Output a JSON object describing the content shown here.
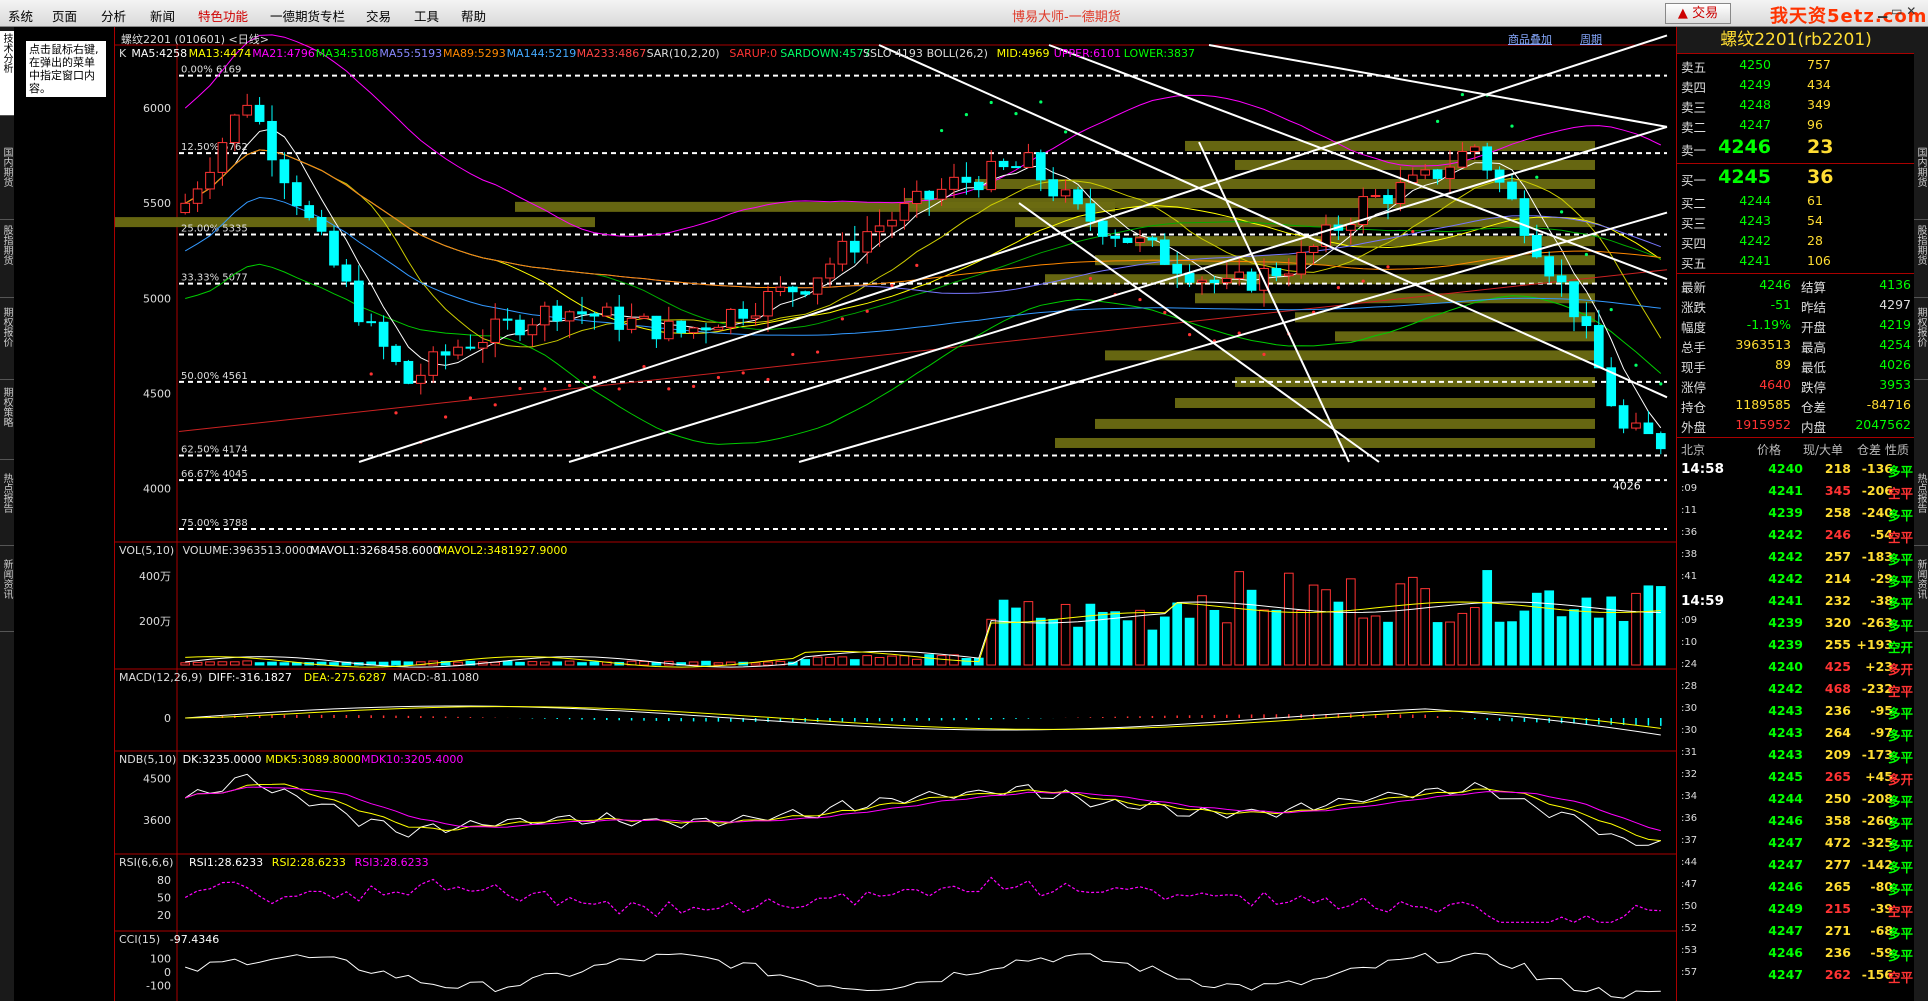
{
  "menu": [
    "系统",
    "页面",
    "分析",
    "新闻",
    "特色功能",
    "一德期货专栏",
    "交易",
    "工具",
    "帮助"
  ],
  "app_title": "博易大师-一德期货",
  "trade_button": "交易",
  "watermark": "我天资5etz.com",
  "left_tabs": [
    "技术分析",
    "国内期货",
    "股指期货",
    "期权报价",
    "期权策略",
    "热点报告",
    "新闻资讯"
  ],
  "right_tabs": [
    "国内期货",
    "股指期货",
    "期权报价",
    "热点报告",
    "新闻资讯"
  ],
  "hint": "点击鼠标右键,在弹出的菜单中指定窗口内容。",
  "chart_title": "螺纹2201 (010601) <日线>",
  "chart_buttons": [
    "商品叠加",
    "周期"
  ],
  "indicators": {
    "main": [
      {
        "t": "K",
        "c": "#dddddd"
      },
      {
        "t": "MA5:4258",
        "c": "#ffffff"
      },
      {
        "t": "MA13:4474",
        "c": "#ffff00"
      },
      {
        "t": "MA21:4796",
        "c": "#ff00ff"
      },
      {
        "t": "MA34:5108",
        "c": "#00ff00"
      },
      {
        "t": "MA55:5193",
        "c": "#8888ff"
      },
      {
        "t": "MA89:5293",
        "c": "#ff8800"
      },
      {
        "t": "MA144:5219",
        "c": "#44aaff"
      },
      {
        "t": "MA233:4867",
        "c": "#ff4444"
      },
      {
        "t": "SAR(10,2,20)",
        "c": "#dddddd"
      },
      {
        "t": "SARUP:0",
        "c": "#ff3333"
      },
      {
        "t": "SARDOWN:4577",
        "c": "#00ff66"
      },
      {
        "t": "SSLO 4193",
        "c": "#dddddd"
      },
      {
        "t": "BOLL(26,2)",
        "c": "#dddddd"
      },
      {
        "t": "MID:4969",
        "c": "#ffff00"
      },
      {
        "t": "UPPER:6101",
        "c": "#ff00ff"
      },
      {
        "t": "LOWER:3837",
        "c": "#00ff00"
      }
    ],
    "vol": [
      {
        "t": "VOL(5,10)",
        "c": "#dddddd"
      },
      {
        "t": "VOLUME:3963513.0000",
        "c": "#dddddd"
      },
      {
        "t": "MAVOL1:3268458.6000",
        "c": "#ffffff"
      },
      {
        "t": "MAVOL2:3481927.9000",
        "c": "#ffff00"
      }
    ],
    "macd": [
      {
        "t": "MACD(12,26,9)",
        "c": "#dddddd"
      },
      {
        "t": "DIFF:-316.1827",
        "c": "#ffffff"
      },
      {
        "t": "DEA:-275.6287",
        "c": "#ffff00"
      },
      {
        "t": "MACD:-81.1080",
        "c": "#dddddd"
      }
    ],
    "ndb": [
      {
        "t": "NDB(5,10)",
        "c": "#dddddd"
      },
      {
        "t": "DK:3235.0000",
        "c": "#ffffff"
      },
      {
        "t": "MDK5:3089.8000",
        "c": "#ffff00"
      },
      {
        "t": "MDK10:3205.4000",
        "c": "#ff00ff"
      }
    ],
    "rsi": [
      {
        "t": "RSI(6,6,6)",
        "c": "#dddddd"
      },
      {
        "t": "RSI1:28.6233",
        "c": "#ffffff"
      },
      {
        "t": "RSI2:28.6233",
        "c": "#ffff00"
      },
      {
        "t": "RSI3:28.6233",
        "c": "#ff00ff"
      }
    ],
    "cci": [
      {
        "t": "CCI(15)",
        "c": "#dddddd"
      },
      {
        "t": "-97.4346",
        "c": "#ffffff"
      }
    ]
  },
  "axis": {
    "price_ticks": [
      "6000",
      "5500",
      "5000",
      "4500",
      "4000"
    ],
    "vol_ticks": [
      "400万",
      "200万"
    ],
    "macd_ticks": [
      "0"
    ],
    "ndb_ticks": [
      "4500",
      "3600"
    ],
    "rsi_ticks": [
      "80",
      "50",
      "20"
    ],
    "cci_ticks": [
      "100",
      "0",
      "-100"
    ]
  },
  "fib_levels": [
    {
      "label": "0.00%  6169",
      "v": 6169
    },
    {
      "label": "12.50%  5762",
      "v": 5762
    },
    {
      "label": "25.00%  5335",
      "v": 5335
    },
    {
      "label": "33.33%  5077",
      "v": 5077
    },
    {
      "label": "50.00%  4561",
      "v": 4561
    },
    {
      "label": "62.50%  4174",
      "v": 4174
    },
    {
      "label": "66.67%  4045",
      "v": 4045
    },
    {
      "label": "75.00%  3788",
      "v": 3788
    }
  ],
  "low_label": "4026",
  "quote": {
    "title": "螺纹2201(rb2201)",
    "asks": [
      {
        "label": "卖五",
        "price": "4250",
        "vol": "757"
      },
      {
        "label": "卖四",
        "price": "4249",
        "vol": "434"
      },
      {
        "label": "卖三",
        "price": "4248",
        "vol": "349"
      },
      {
        "label": "卖二",
        "price": "4247",
        "vol": "96"
      },
      {
        "label": "卖一",
        "price": "4246",
        "vol": "23"
      }
    ],
    "bids": [
      {
        "label": "买一",
        "price": "4245",
        "vol": "36"
      },
      {
        "label": "买二",
        "price": "4244",
        "vol": "61"
      },
      {
        "label": "买三",
        "price": "4243",
        "vol": "54"
      },
      {
        "label": "买四",
        "price": "4242",
        "vol": "28"
      },
      {
        "label": "买五",
        "price": "4241",
        "vol": "106"
      }
    ],
    "stats": [
      {
        "l1": "最新",
        "v1": "4246",
        "c1": "#00ff00",
        "l2": "结算",
        "v2": "4136",
        "c2": "#00ff00"
      },
      {
        "l1": "涨跌",
        "v1": "-51",
        "c1": "#00ff00",
        "l2": "昨结",
        "v2": "4297",
        "c2": "#dddddd"
      },
      {
        "l1": "幅度",
        "v1": "-1.19%",
        "c1": "#00ff00",
        "l2": "开盘",
        "v2": "4219",
        "c2": "#00ff00"
      },
      {
        "l1": "总手",
        "v1": "3963513",
        "c1": "#ffdd33",
        "l2": "最高",
        "v2": "4254",
        "c2": "#00ff00"
      },
      {
        "l1": "现手",
        "v1": "89",
        "c1": "#ffdd33",
        "l2": "最低",
        "v2": "4026",
        "c2": "#00ff00"
      },
      {
        "l1": "涨停",
        "v1": "4640",
        "c1": "#ff3333",
        "l2": "跌停",
        "v2": "3953",
        "c2": "#00ff00"
      },
      {
        "l1": "持仓",
        "v1": "1189585",
        "c1": "#ffdd33",
        "l2": "仓差",
        "v2": "-84716",
        "c2": "#ffdd33"
      },
      {
        "l1": "外盘",
        "v1": "1915952",
        "c1": "#ff3333",
        "l2": "内盘",
        "v2": "2047562",
        "c2": "#00ff00"
      }
    ],
    "tick_headers": [
      "北京",
      "价格",
      "现/大单",
      "仓差",
      "性质"
    ],
    "ticks": [
      {
        "t": "14:58",
        "p": "4240",
        "v": "218",
        "o": "-136",
        "n": "多平",
        "pc": "#00ff00",
        "vc": "#ffdd33",
        "oc": "#ffdd33",
        "nc": "#00ff00",
        "big": true
      },
      {
        "t": ":09",
        "p": "4241",
        "v": "345",
        "o": "-206",
        "n": "空平",
        "pc": "#00ff00",
        "vc": "#ff3333",
        "oc": "#ffdd33",
        "nc": "#ff3333",
        "big": false
      },
      {
        "t": ":11",
        "p": "4239",
        "v": "258",
        "o": "-240",
        "n": "多平",
        "pc": "#00ff00",
        "vc": "#ffdd33",
        "oc": "#ffdd33",
        "nc": "#00ff00",
        "big": false
      },
      {
        "t": ":36",
        "p": "4242",
        "v": "246",
        "o": "-54",
        "n": "空平",
        "pc": "#00ff00",
        "vc": "#ff3333",
        "oc": "#ffdd33",
        "nc": "#ff3333",
        "big": false
      },
      {
        "t": ":38",
        "p": "4242",
        "v": "257",
        "o": "-183",
        "n": "多平",
        "pc": "#00ff00",
        "vc": "#ffdd33",
        "oc": "#ffdd33",
        "nc": "#00ff00",
        "big": false
      },
      {
        "t": ":41",
        "p": "4242",
        "v": "214",
        "o": "-29",
        "n": "多平",
        "pc": "#00ff00",
        "vc": "#ffdd33",
        "oc": "#ffdd33",
        "nc": "#00ff00",
        "big": false
      },
      {
        "t": "14:59",
        "p": "4241",
        "v": "232",
        "o": "-38",
        "n": "多平",
        "pc": "#00ff00",
        "vc": "#ffdd33",
        "oc": "#ffdd33",
        "nc": "#00ff00",
        "big": true
      },
      {
        "t": ":09",
        "p": "4239",
        "v": "320",
        "o": "-263",
        "n": "多平",
        "pc": "#00ff00",
        "vc": "#ffdd33",
        "oc": "#ffdd33",
        "nc": "#00ff00",
        "big": false
      },
      {
        "t": ":10",
        "p": "4239",
        "v": "255",
        "o": "+193",
        "n": "空开",
        "pc": "#00ff00",
        "vc": "#ffdd33",
        "oc": "#ffdd33",
        "nc": "#00ff00",
        "big": false
      },
      {
        "t": ":24",
        "p": "4240",
        "v": "425",
        "o": "+23",
        "n": "多开",
        "pc": "#00ff00",
        "vc": "#ff3333",
        "oc": "#ffdd33",
        "nc": "#ff3333",
        "big": false
      },
      {
        "t": ":28",
        "p": "4242",
        "v": "468",
        "o": "-232",
        "n": "空平",
        "pc": "#00ff00",
        "vc": "#ff3333",
        "oc": "#ffdd33",
        "nc": "#ff3333",
        "big": false
      },
      {
        "t": ":30",
        "p": "4243",
        "v": "236",
        "o": "-95",
        "n": "多平",
        "pc": "#00ff00",
        "vc": "#ffdd33",
        "oc": "#ffdd33",
        "nc": "#00ff00",
        "big": false
      },
      {
        "t": ":30",
        "p": "4243",
        "v": "264",
        "o": "-97",
        "n": "多平",
        "pc": "#00ff00",
        "vc": "#ffdd33",
        "oc": "#ffdd33",
        "nc": "#00ff00",
        "big": false
      },
      {
        "t": ":31",
        "p": "4243",
        "v": "209",
        "o": "-173",
        "n": "多平",
        "pc": "#00ff00",
        "vc": "#ffdd33",
        "oc": "#ffdd33",
        "nc": "#00ff00",
        "big": false
      },
      {
        "t": ":32",
        "p": "4245",
        "v": "265",
        "o": "+45",
        "n": "多开",
        "pc": "#00ff00",
        "vc": "#ff3333",
        "oc": "#ffdd33",
        "nc": "#ff3333",
        "big": false
      },
      {
        "t": ":34",
        "p": "4244",
        "v": "250",
        "o": "-208",
        "n": "多平",
        "pc": "#00ff00",
        "vc": "#ffdd33",
        "oc": "#ffdd33",
        "nc": "#00ff00",
        "big": false
      },
      {
        "t": ":36",
        "p": "4246",
        "v": "358",
        "o": "-260",
        "n": "多平",
        "pc": "#00ff00",
        "vc": "#ffdd33",
        "oc": "#ffdd33",
        "nc": "#00ff00",
        "big": false
      },
      {
        "t": ":37",
        "p": "4247",
        "v": "472",
        "o": "-325",
        "n": "多平",
        "pc": "#00ff00",
        "vc": "#ffdd33",
        "oc": "#ffdd33",
        "nc": "#00ff00",
        "big": false
      },
      {
        "t": ":44",
        "p": "4247",
        "v": "277",
        "o": "-142",
        "n": "多平",
        "pc": "#00ff00",
        "vc": "#ffdd33",
        "oc": "#ffdd33",
        "nc": "#00ff00",
        "big": false
      },
      {
        "t": ":47",
        "p": "4246",
        "v": "265",
        "o": "-80",
        "n": "多平",
        "pc": "#00ff00",
        "vc": "#ffdd33",
        "oc": "#ffdd33",
        "nc": "#00ff00",
        "big": false
      },
      {
        "t": ":50",
        "p": "4249",
        "v": "215",
        "o": "-39",
        "n": "空平",
        "pc": "#00ff00",
        "vc": "#ff3333",
        "oc": "#ffdd33",
        "nc": "#ff3333",
        "big": false
      },
      {
        "t": ":52",
        "p": "4247",
        "v": "271",
        "o": "-68",
        "n": "多平",
        "pc": "#00ff00",
        "vc": "#ffdd33",
        "oc": "#ffdd33",
        "nc": "#00ff00",
        "big": false
      },
      {
        "t": ":53",
        "p": "4246",
        "v": "236",
        "o": "-59",
        "n": "多平",
        "pc": "#00ff00",
        "vc": "#ffdd33",
        "oc": "#ffdd33",
        "nc": "#00ff00",
        "big": false
      },
      {
        "t": ":57",
        "p": "4247",
        "v": "262",
        "o": "-156",
        "n": "空平",
        "pc": "#00ff00",
        "vc": "#ff3333",
        "oc": "#ffdd33",
        "nc": "#ff3333",
        "big": false
      }
    ]
  }
}
